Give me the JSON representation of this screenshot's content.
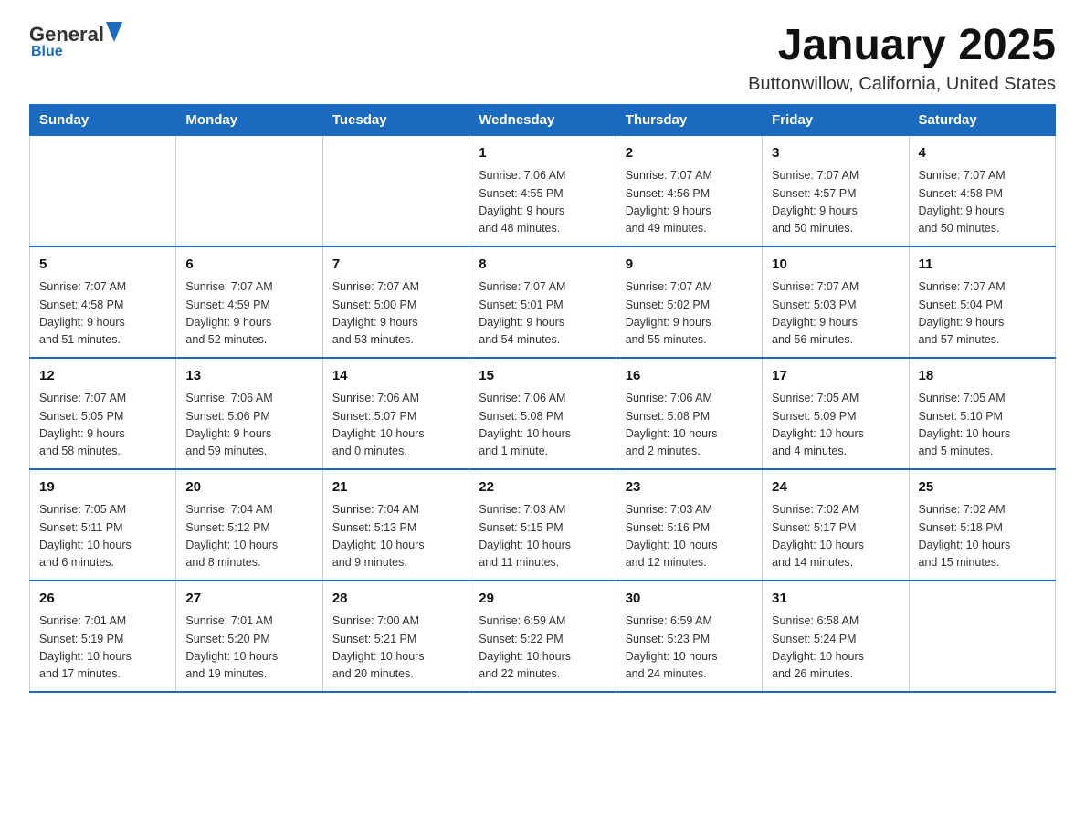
{
  "logo": {
    "general": "General",
    "blue": "Blue"
  },
  "title": "January 2025",
  "subtitle": "Buttonwillow, California, United States",
  "weekdays": [
    "Sunday",
    "Monday",
    "Tuesday",
    "Wednesday",
    "Thursday",
    "Friday",
    "Saturday"
  ],
  "weeks": [
    [
      {
        "day": "",
        "info": ""
      },
      {
        "day": "",
        "info": ""
      },
      {
        "day": "",
        "info": ""
      },
      {
        "day": "1",
        "info": "Sunrise: 7:06 AM\nSunset: 4:55 PM\nDaylight: 9 hours\nand 48 minutes."
      },
      {
        "day": "2",
        "info": "Sunrise: 7:07 AM\nSunset: 4:56 PM\nDaylight: 9 hours\nand 49 minutes."
      },
      {
        "day": "3",
        "info": "Sunrise: 7:07 AM\nSunset: 4:57 PM\nDaylight: 9 hours\nand 50 minutes."
      },
      {
        "day": "4",
        "info": "Sunrise: 7:07 AM\nSunset: 4:58 PM\nDaylight: 9 hours\nand 50 minutes."
      }
    ],
    [
      {
        "day": "5",
        "info": "Sunrise: 7:07 AM\nSunset: 4:58 PM\nDaylight: 9 hours\nand 51 minutes."
      },
      {
        "day": "6",
        "info": "Sunrise: 7:07 AM\nSunset: 4:59 PM\nDaylight: 9 hours\nand 52 minutes."
      },
      {
        "day": "7",
        "info": "Sunrise: 7:07 AM\nSunset: 5:00 PM\nDaylight: 9 hours\nand 53 minutes."
      },
      {
        "day": "8",
        "info": "Sunrise: 7:07 AM\nSunset: 5:01 PM\nDaylight: 9 hours\nand 54 minutes."
      },
      {
        "day": "9",
        "info": "Sunrise: 7:07 AM\nSunset: 5:02 PM\nDaylight: 9 hours\nand 55 minutes."
      },
      {
        "day": "10",
        "info": "Sunrise: 7:07 AM\nSunset: 5:03 PM\nDaylight: 9 hours\nand 56 minutes."
      },
      {
        "day": "11",
        "info": "Sunrise: 7:07 AM\nSunset: 5:04 PM\nDaylight: 9 hours\nand 57 minutes."
      }
    ],
    [
      {
        "day": "12",
        "info": "Sunrise: 7:07 AM\nSunset: 5:05 PM\nDaylight: 9 hours\nand 58 minutes."
      },
      {
        "day": "13",
        "info": "Sunrise: 7:06 AM\nSunset: 5:06 PM\nDaylight: 9 hours\nand 59 minutes."
      },
      {
        "day": "14",
        "info": "Sunrise: 7:06 AM\nSunset: 5:07 PM\nDaylight: 10 hours\nand 0 minutes."
      },
      {
        "day": "15",
        "info": "Sunrise: 7:06 AM\nSunset: 5:08 PM\nDaylight: 10 hours\nand 1 minute."
      },
      {
        "day": "16",
        "info": "Sunrise: 7:06 AM\nSunset: 5:08 PM\nDaylight: 10 hours\nand 2 minutes."
      },
      {
        "day": "17",
        "info": "Sunrise: 7:05 AM\nSunset: 5:09 PM\nDaylight: 10 hours\nand 4 minutes."
      },
      {
        "day": "18",
        "info": "Sunrise: 7:05 AM\nSunset: 5:10 PM\nDaylight: 10 hours\nand 5 minutes."
      }
    ],
    [
      {
        "day": "19",
        "info": "Sunrise: 7:05 AM\nSunset: 5:11 PM\nDaylight: 10 hours\nand 6 minutes."
      },
      {
        "day": "20",
        "info": "Sunrise: 7:04 AM\nSunset: 5:12 PM\nDaylight: 10 hours\nand 8 minutes."
      },
      {
        "day": "21",
        "info": "Sunrise: 7:04 AM\nSunset: 5:13 PM\nDaylight: 10 hours\nand 9 minutes."
      },
      {
        "day": "22",
        "info": "Sunrise: 7:03 AM\nSunset: 5:15 PM\nDaylight: 10 hours\nand 11 minutes."
      },
      {
        "day": "23",
        "info": "Sunrise: 7:03 AM\nSunset: 5:16 PM\nDaylight: 10 hours\nand 12 minutes."
      },
      {
        "day": "24",
        "info": "Sunrise: 7:02 AM\nSunset: 5:17 PM\nDaylight: 10 hours\nand 14 minutes."
      },
      {
        "day": "25",
        "info": "Sunrise: 7:02 AM\nSunset: 5:18 PM\nDaylight: 10 hours\nand 15 minutes."
      }
    ],
    [
      {
        "day": "26",
        "info": "Sunrise: 7:01 AM\nSunset: 5:19 PM\nDaylight: 10 hours\nand 17 minutes."
      },
      {
        "day": "27",
        "info": "Sunrise: 7:01 AM\nSunset: 5:20 PM\nDaylight: 10 hours\nand 19 minutes."
      },
      {
        "day": "28",
        "info": "Sunrise: 7:00 AM\nSunset: 5:21 PM\nDaylight: 10 hours\nand 20 minutes."
      },
      {
        "day": "29",
        "info": "Sunrise: 6:59 AM\nSunset: 5:22 PM\nDaylight: 10 hours\nand 22 minutes."
      },
      {
        "day": "30",
        "info": "Sunrise: 6:59 AM\nSunset: 5:23 PM\nDaylight: 10 hours\nand 24 minutes."
      },
      {
        "day": "31",
        "info": "Sunrise: 6:58 AM\nSunset: 5:24 PM\nDaylight: 10 hours\nand 26 minutes."
      },
      {
        "day": "",
        "info": ""
      }
    ]
  ]
}
